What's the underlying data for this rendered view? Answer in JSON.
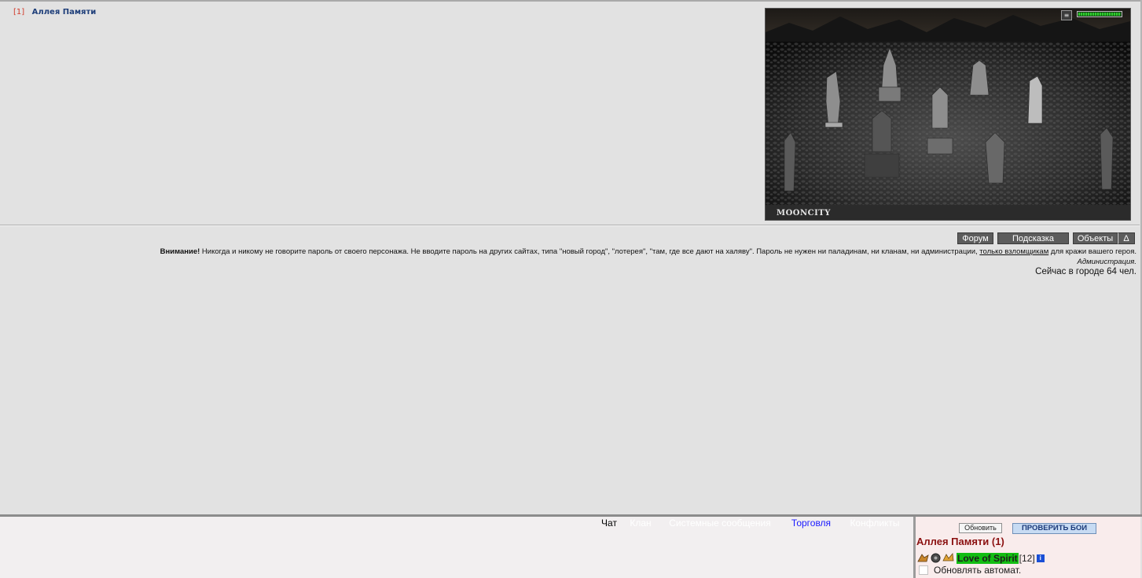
{
  "location": {
    "number": "[1]",
    "name": "Аллея Памяти"
  },
  "scene": {
    "logo_text": "MOONCITY",
    "hp_fraction": 1.0,
    "hp_color": "#2ecc2e"
  },
  "nav": {
    "forum": "Форум",
    "hint": "Подсказка",
    "objects": "Объекты",
    "delta": "Δ"
  },
  "warning": {
    "bold": "Внимание!",
    "text_before_link": " Никогда и никому не говорите пароль от своего персонажа. Не вводите пароль на других сайтах, типа \"новый город\", \"лотерея\", \"там, где все дают на халяву\". Пароль не нужен ни паладинам, ни кланам, ни администрации, ",
    "link": "только взломщикам",
    "text_after_link": " для кражи вашего героя.",
    "signature": "Администрация."
  },
  "online_text": "Сейчас в городе 64 чел.",
  "chat_tabs": [
    {
      "label": "Чат",
      "active": true
    },
    {
      "label": "Клан",
      "active": false
    },
    {
      "label": "Системные сообщения",
      "active": false
    },
    {
      "label": "Торговля",
      "active": false
    },
    {
      "label": "Конфликты",
      "active": false
    }
  ],
  "users_panel": {
    "refresh_button": "Обновить",
    "check_fights_button": "ПРОВЕРИТЬ БОИ",
    "room_title": "Аллея Памяти (1)",
    "user": {
      "name": "Love of Spirit",
      "level": "[12]",
      "info_icon": "i"
    },
    "auto_refresh_label": "Обновлять автомат.",
    "auto_refresh_checked": false
  },
  "colors": {
    "page_bg": "#e2e2e2",
    "room_title": "#8b1111",
    "user_highlight": "#13bd13",
    "link_blue": "#1f3f7a"
  }
}
